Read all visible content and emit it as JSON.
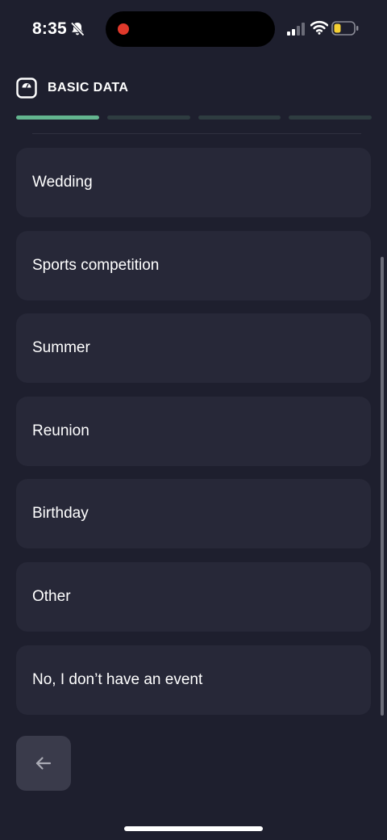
{
  "status_bar": {
    "time": "8:35",
    "icons": [
      "bell-off-icon",
      "signal-icon",
      "wifi-icon",
      "battery-icon"
    ]
  },
  "header": {
    "icon": "scale-icon",
    "title": "BASIC DATA"
  },
  "progress": {
    "total_steps": 4,
    "completed_steps": 1
  },
  "options": [
    {
      "label": "Wedding"
    },
    {
      "label": "Sports competition"
    },
    {
      "label": "Summer"
    },
    {
      "label": "Reunion"
    },
    {
      "label": "Birthday"
    },
    {
      "label": "Other"
    },
    {
      "label": "No, I don’t have an event"
    }
  ],
  "back_button": {
    "icon": "arrow-left-icon"
  },
  "colors": {
    "background": "#1e1f2e",
    "card": "#272838",
    "progress_active": "#63b58f",
    "progress_inactive": "#2e3c40",
    "record_dot": "#e0392b",
    "battery_level": "#f5d033"
  }
}
